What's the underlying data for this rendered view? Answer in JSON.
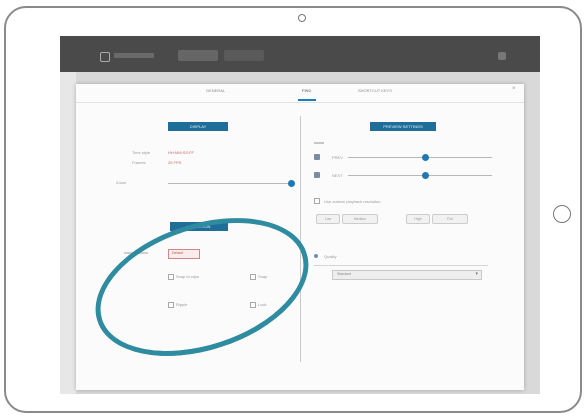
{
  "tabs": [
    {
      "label": "GENERAL",
      "active": false
    },
    {
      "label": "FIND",
      "active": true
    },
    {
      "label": "SHORTCUT KEYS",
      "active": false
    }
  ],
  "left_panel": {
    "header": "DISPLAY",
    "rows": [
      {
        "label": "Time style",
        "value": "HH:MM:SS:FF"
      },
      {
        "label": "Frames",
        "value": "25 FPS"
      }
    ],
    "slider_label": "Zoom"
  },
  "right_panel": {
    "header": "PREVIEW SETTINGS",
    "rows": [
      {
        "value": "PREV"
      },
      {
        "value": "NEXT"
      }
    ]
  },
  "lower_panel": {
    "header": "SELECTION",
    "field_value": "Default",
    "options": [
      {
        "label": "Snap to clips",
        "checked": true
      },
      {
        "label": "Snap",
        "checked": false
      },
      {
        "label": "Ripple",
        "checked": true
      },
      {
        "label": "Lock",
        "checked": false
      }
    ]
  },
  "right_lower": {
    "checkbox_label": "Use custom playback resolution",
    "pills": [
      "Low",
      "Medium",
      "High",
      "Full"
    ],
    "select_label": "Quality",
    "select_value": "Standard"
  },
  "colors": {
    "accent": "#1f6d99",
    "annotation": "#2e8ba0"
  }
}
